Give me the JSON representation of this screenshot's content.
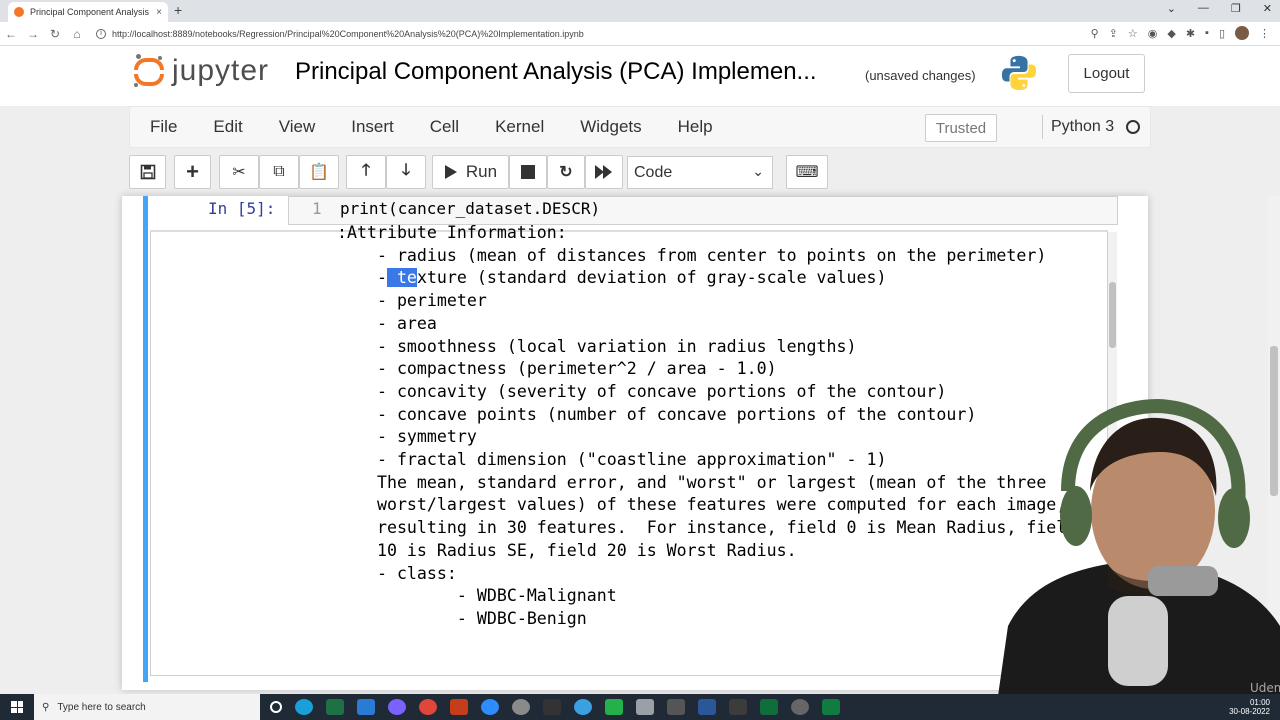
{
  "browser": {
    "tab_title": "Principal Component Analysis (P...",
    "tab_close": "×",
    "new_tab": "+",
    "url": "http://localhost:8889/notebooks/Regression/Principal%20Component%20Analysis%20(PCA)%20Implementation.ipynb"
  },
  "header": {
    "logo_text": "jupyter",
    "notebook_title": "Principal Component Analysis (PCA) Implemen...",
    "save_status": "(unsaved changes)",
    "logout_label": "Logout"
  },
  "menubar": {
    "items": [
      {
        "label": "File"
      },
      {
        "label": "Edit"
      },
      {
        "label": "View"
      },
      {
        "label": "Insert"
      },
      {
        "label": "Cell"
      },
      {
        "label": "Kernel"
      },
      {
        "label": "Widgets"
      },
      {
        "label": "Help"
      }
    ],
    "trusted_label": "Trusted",
    "kernel_name": "Python 3"
  },
  "toolbar": {
    "run_label": "Run",
    "cell_type": "Code"
  },
  "cell": {
    "prompt": "In [5]:",
    "line_number": "1",
    "code": "print(cancer_dataset.DESCR)",
    "output_lines": {
      "l0": ":Attribute Information:",
      "l1": "    - radius (mean of distances from center to points on the perimeter)",
      "l2_pre": "    -",
      "l2_hl": " te",
      "l2_post": "xture (standard deviation of gray-scale values)",
      "l3": "    - perimeter",
      "l4": "    - area",
      "l5": "    - smoothness (local variation in radius lengths)",
      "l6": "    - compactness (perimeter^2 / area - 1.0)",
      "l7": "    - concavity (severity of concave portions of the contour)",
      "l8": "    - concave points (number of concave portions of the contour)",
      "l9": "    - symmetry",
      "l10": "    - fractal dimension (\"coastline approximation\" - 1)",
      "l11": "",
      "l12": "    The mean, standard error, and \"worst\" or largest (mean of the three",
      "l13": "    worst/largest values) of these features were computed for each image,",
      "l14": "    resulting in 30 features.  For instance, field 0 is Mean Radius, field",
      "l15": "    10 is Radius SE, field 20 is Worst Radius.",
      "l16": "",
      "l17": "    - class:",
      "l18": "            - WDBC-Malignant",
      "l19": "            - WDBC-Benign"
    }
  },
  "taskbar": {
    "search_placeholder": "Type here to search",
    "time": "01:00",
    "date": "30-08-2022"
  },
  "colors": {
    "accent": "#42a5f5",
    "jupyter_orange": "#f37726",
    "selection": "#3b78e7"
  }
}
